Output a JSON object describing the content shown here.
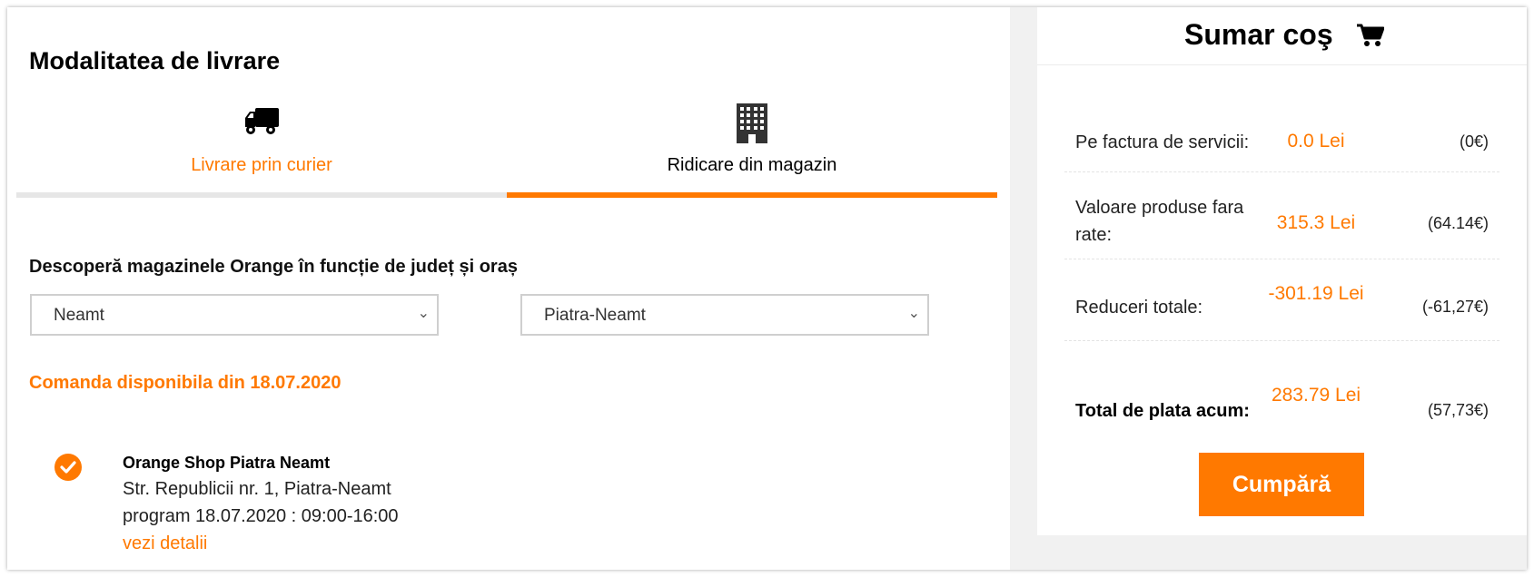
{
  "delivery": {
    "title": "Modalitatea de livrare",
    "tabs": [
      {
        "label": "Livrare prin curier",
        "icon": "truck-icon"
      },
      {
        "label": "Ridicare din magazin",
        "icon": "building-icon"
      }
    ],
    "active_tab": "Ridicare din magazin"
  },
  "store_finder": {
    "label": "Descoperă magazinele Orange în funcție de județ și oraș",
    "county_selected": "Neamt",
    "city_selected": "Piatra-Neamt",
    "availability": "Comanda disponibila din 18.07.2020",
    "store": {
      "name": "Orange Shop Piatra Neamt",
      "address": "Str. Republicii nr. 1, Piatra-Neamt",
      "program": "program 18.07.2020 : 09:00-16:00",
      "details_link": "vezi detalii",
      "selected": true
    }
  },
  "summary": {
    "title": "Sumar coş",
    "rows": [
      {
        "label": "Pe factura de servicii:",
        "value": "0.0 Lei",
        "eur": "(0€)"
      },
      {
        "label": "Valoare produse fara rate:",
        "value": "315.3 Lei",
        "eur": "(64.14€)"
      },
      {
        "label": "Reduceri totale:",
        "value": "-301.19 Lei",
        "eur": "(-61,27€)"
      },
      {
        "label": "Total de plata acum:",
        "value": "283.79 Lei",
        "eur": "(57,73€)"
      }
    ],
    "buy_label": "Cumpără"
  },
  "colors": {
    "accent": "#ff7900",
    "tab_inactive_bar": "#e6e6e6",
    "side_background": "#f1f1f1"
  }
}
